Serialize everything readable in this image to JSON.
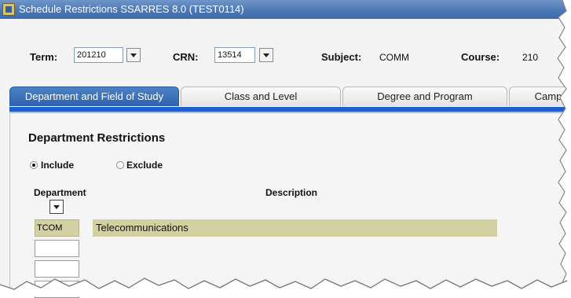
{
  "window": {
    "title": "Schedule Restrictions  SSARRES  8.0  (TEST0114)"
  },
  "key_block": {
    "term_label": "Term:",
    "term_value": "201210",
    "crn_label": "CRN:",
    "crn_value": "13514",
    "subject_label": "Subject:",
    "subject_value": "COMM",
    "course_label": "Course:",
    "course_value": "210"
  },
  "tabs": [
    {
      "label": "Department and Field of Study",
      "active": true
    },
    {
      "label": "Class and Level",
      "active": false
    },
    {
      "label": "Degree and Program",
      "active": false
    },
    {
      "label": "Camp",
      "active": false
    }
  ],
  "section": {
    "title": "Department Restrictions",
    "include_label": "Include",
    "exclude_label": "Exclude",
    "selected": "Include"
  },
  "table": {
    "columns": {
      "department": "Department",
      "description": "Description"
    },
    "rows": [
      {
        "code": "TCOM",
        "description": "Telecommunications"
      },
      {
        "code": "",
        "description": ""
      },
      {
        "code": "",
        "description": ""
      }
    ]
  },
  "colors": {
    "title_bar": "#4a76b4",
    "active_tab": "#2c63ad",
    "tab_underline": "#1f5fcf",
    "selected_row": "#d3d0a3"
  }
}
